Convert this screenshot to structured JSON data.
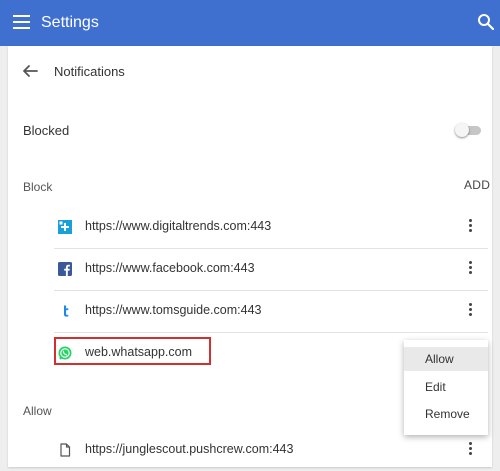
{
  "app": {
    "title": "Settings"
  },
  "page": {
    "title": "Notifications"
  },
  "blocked_toggle": {
    "label": "Blocked",
    "state": "off"
  },
  "block_section": {
    "label": "Block",
    "add_label": "ADD",
    "sites": [
      {
        "url": "https://www.digitaltrends.com:443",
        "icon": "digitaltrends-icon"
      },
      {
        "url": "https://www.facebook.com:443",
        "icon": "facebook-icon"
      },
      {
        "url": "https://www.tomsguide.com:443",
        "icon": "tomsguide-icon"
      },
      {
        "url": "web.whatsapp.com",
        "icon": "whatsapp-icon"
      }
    ]
  },
  "allow_section": {
    "label": "Allow",
    "sites": [
      {
        "url": "https://junglescout.pushcrew.com:443",
        "icon": "file-icon"
      }
    ]
  },
  "context_menu": {
    "items": [
      {
        "label": "Allow"
      },
      {
        "label": "Edit"
      },
      {
        "label": "Remove"
      }
    ]
  },
  "colors": {
    "header": "#3f6fcf",
    "highlight": "#d32f2f",
    "facebook": "#3b5998",
    "whatsapp": "#25d366",
    "tomsguide": "#1e88e5",
    "digitaltrends": "#1aa0d8"
  }
}
